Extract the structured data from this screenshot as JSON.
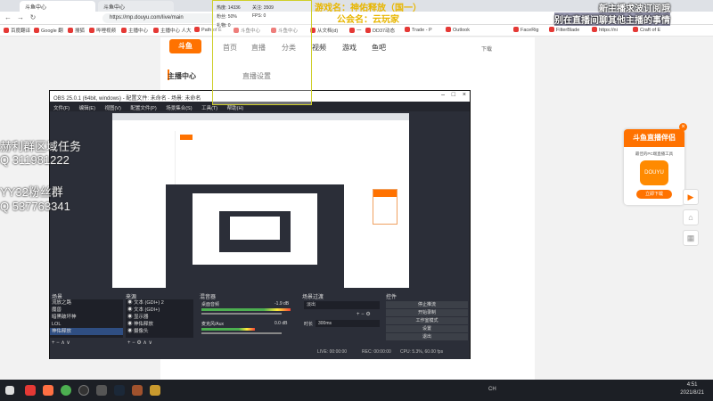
{
  "browser": {
    "tabs": [
      {
        "label": "斗鱼中心"
      },
      {
        "label": "斗鱼中心"
      }
    ],
    "url": "https://mp.douyu.com/live/main",
    "bookmarks": [
      "百度翻译",
      "Google 翻",
      "搜狐",
      "哔哩视频",
      "主播中心",
      "主播中心 人大",
      "Path of E",
      "斗鱼中心",
      "斗鱼中心",
      "从文档(d)",
      "一",
      "DD37动态",
      "Trade - P",
      "Outlook",
      "FaceRig",
      "FilterBlade",
      "https://ni",
      "Craft of E"
    ]
  },
  "site": {
    "logo": "斗鱼",
    "logo_sub": "DOUYU.COM",
    "nav": [
      "首页",
      "直播",
      "分类",
      "视频",
      "游戏",
      "鱼吧"
    ],
    "sidebar_heading": "主播中心",
    "content_heading": "直播设置",
    "topright": "下载"
  },
  "stream_overlay": {
    "stats": [
      {
        "label": "热度",
        "value": "14336"
      },
      {
        "label": "关注",
        "value": "3509"
      },
      {
        "label": "粉丝",
        "value": "50%"
      },
      {
        "label": "FPS",
        "value": "0"
      },
      {
        "label": "礼物",
        "value": "0"
      }
    ],
    "game_title": "游戏名：神佑释放（国一）",
    "guild": "公会名：云玩家",
    "danmu": [
      "新主播求波订阅哦",
      "别在直播间聊其他主播的事情"
    ],
    "left_text": [
      "赫利群区域任务",
      "Q 311981222",
      "YY32粉丝群",
      "Q 537763341"
    ]
  },
  "promo": {
    "heading": "斗鱼直播伴侣",
    "desc": "最佳的PC端直播工具",
    "icon_text": "DOUYU",
    "button": "立即下载"
  },
  "obs": {
    "title": "OBS 25.0.1 (64bit, windows) - 配置文件: 未命名 - 场景: 未命名",
    "menu": [
      "文件(F)",
      "编辑(E)",
      "视图(V)",
      "配置文件(P)",
      "场景集合(S)",
      "工具(T)",
      "帮助(H)"
    ],
    "docks": {
      "scenes": {
        "title": "场景",
        "items": [
          "流放之路",
          "魔兽",
          "暗黑破坏神",
          "LOL",
          "神佑释放"
        ]
      },
      "sources": {
        "title": "来源",
        "items": [
          "文本 (GDI+) 2",
          "文本 (GDI+)",
          "显示器",
          "神佑释放",
          "摄像头"
        ]
      },
      "mixer": {
        "title": "混音器",
        "items": [
          {
            "name": "桌面音频",
            "db": "-1.9 dB"
          },
          {
            "name": "麦克风/Aux",
            "db": "0.0 dB"
          }
        ]
      },
      "transitions": {
        "title": "场景过渡",
        "mode": "淡出",
        "duration_label": "时长",
        "duration": "300ms"
      },
      "controls": {
        "title": "控件",
        "buttons": [
          "停止推流",
          "开始录制",
          "工作室模式",
          "设置",
          "退出"
        ]
      }
    },
    "status": {
      "live": "LIVE: 00:00:00",
      "rec": "REC: 00:00:00",
      "cpu": "CPU: 5.3%, 60.00 fps"
    }
  },
  "taskbar": {
    "time": "4:51",
    "date": "2021/8/21",
    "lang": "CH"
  }
}
